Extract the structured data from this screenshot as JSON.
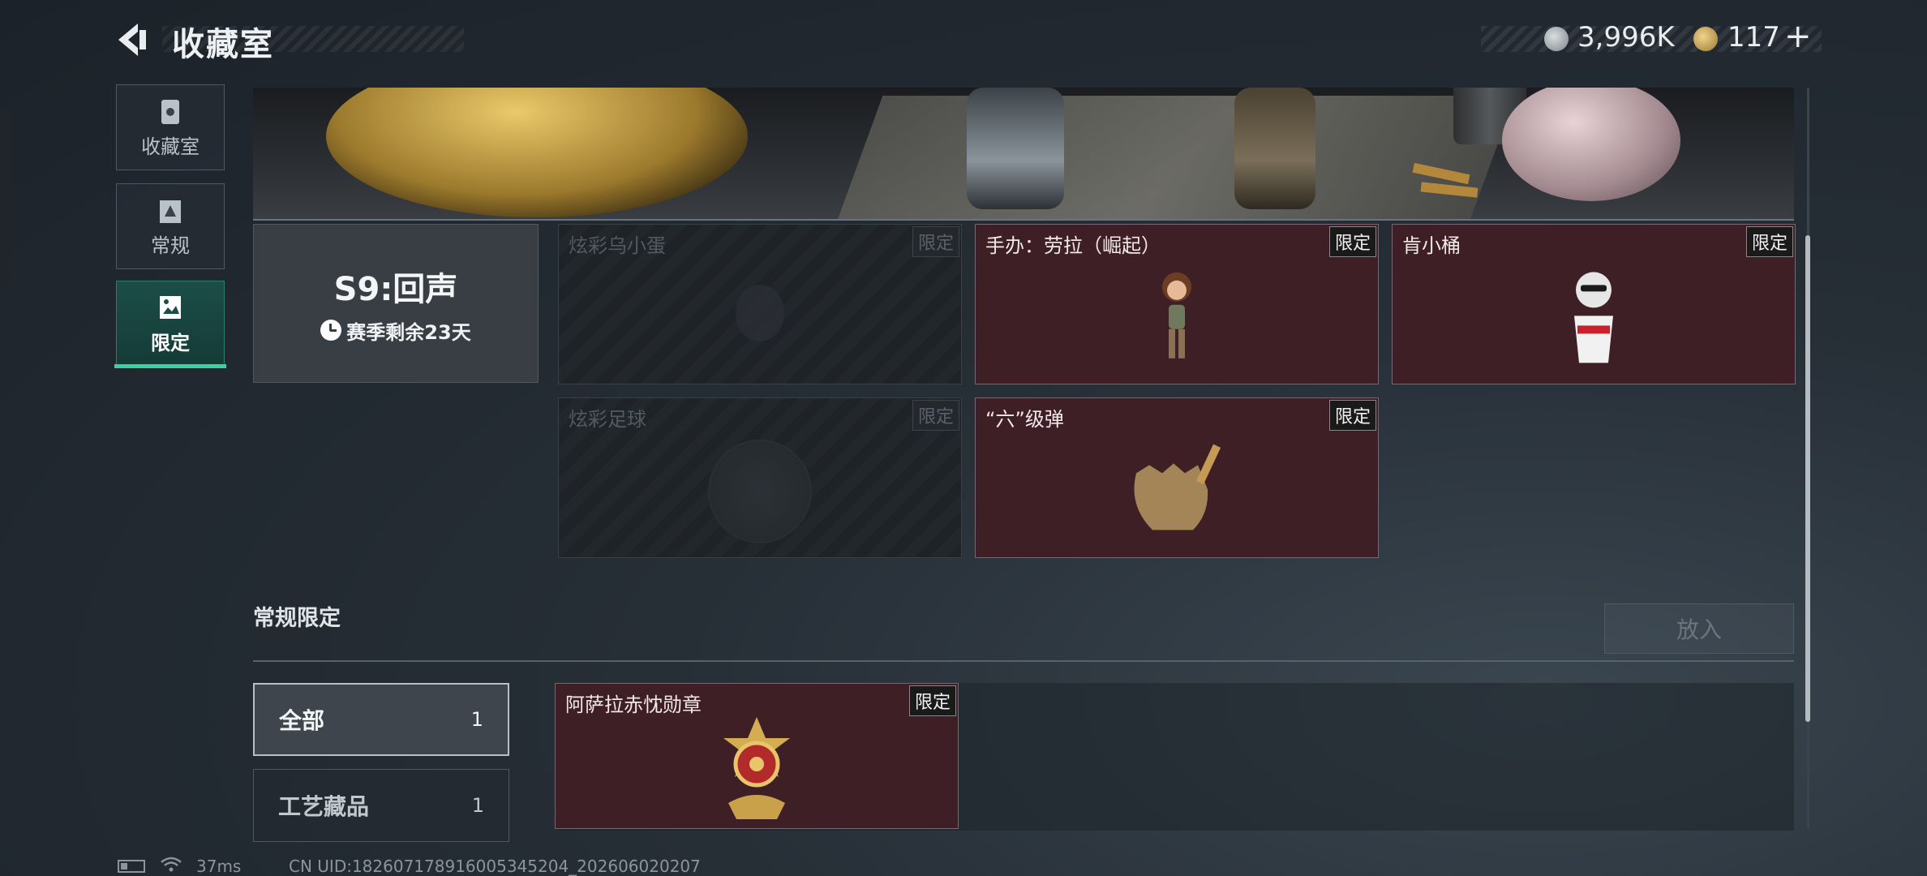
{
  "header": {
    "title": "收藏室",
    "currency": [
      {
        "icon": "silver-coin-icon",
        "value": "3,996K"
      },
      {
        "icon": "gold-coin-icon",
        "value": "117"
      }
    ],
    "add_label": "+"
  },
  "sidebar": {
    "items": [
      {
        "label": "收藏室",
        "icon": "trash-can-icon"
      },
      {
        "label": "常规",
        "icon": "document-icon"
      },
      {
        "label": "限定",
        "icon": "image-frame-icon",
        "selected": true
      }
    ]
  },
  "season": {
    "name": "S9:回声",
    "remaining": "赛季剩余23天"
  },
  "items": [
    {
      "name": "炫彩乌小蛋",
      "tag": "限定",
      "owned": false
    },
    {
      "name": "手办：劳拉（崛起）",
      "tag": "限定",
      "owned": true
    },
    {
      "name": "肯小桶",
      "tag": "限定",
      "owned": true
    },
    {
      "name": "炫彩足球",
      "tag": "限定",
      "owned": false
    },
    {
      "name": "“六”级弹",
      "tag": "限定",
      "owned": true
    }
  ],
  "regular_limited": {
    "title": "常规限定",
    "put_button": "放入",
    "filters": [
      {
        "label": "全部",
        "count": "1"
      },
      {
        "label": "工艺藏品",
        "count": "1"
      }
    ],
    "items": [
      {
        "name": "阿萨拉赤忱勋章",
        "tag": "限定",
        "owned": true
      }
    ]
  },
  "footer": {
    "ping": "37ms",
    "uid": "CN UID:182607178916005345204_202606020207"
  },
  "colors": {
    "accent": "#3ad29f",
    "owned_card": "#3e1f26",
    "background": "#262e36"
  }
}
